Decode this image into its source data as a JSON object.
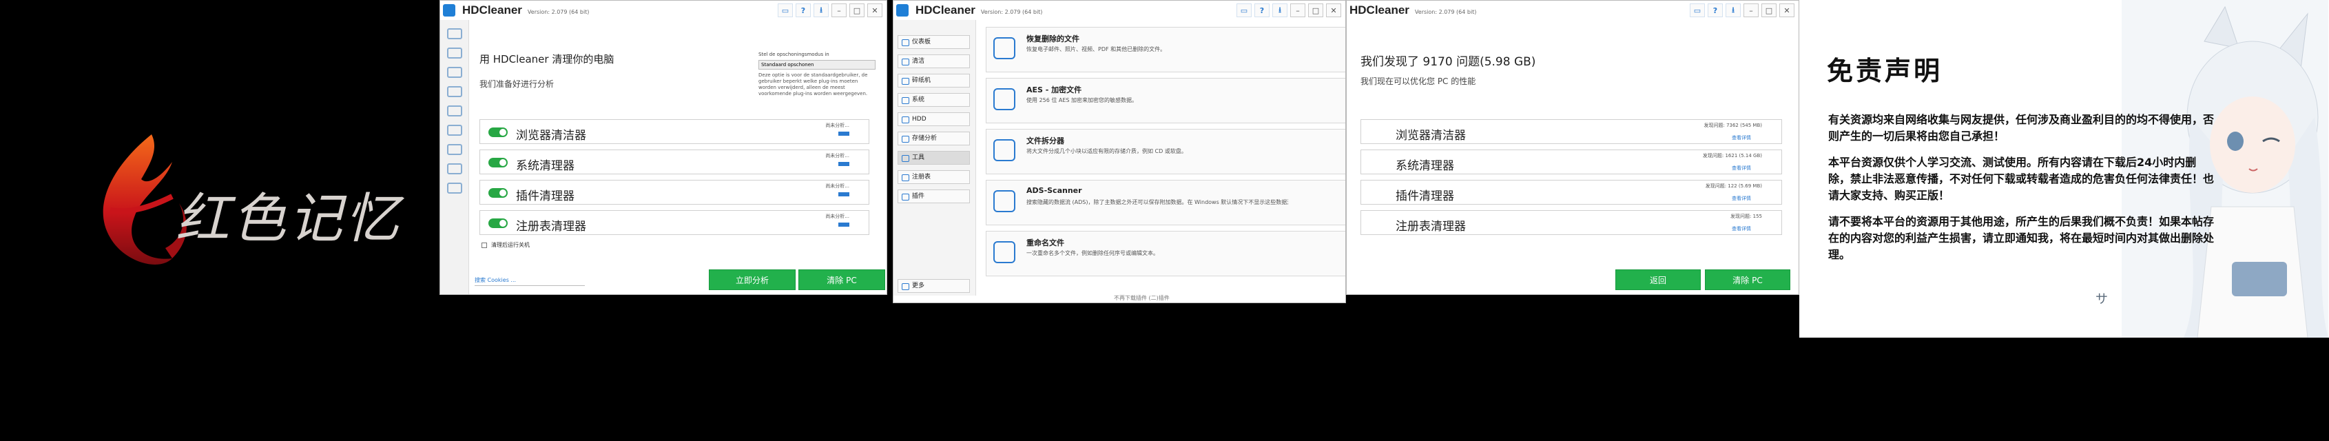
{
  "logo": {
    "text": "红色记忆"
  },
  "window1": {
    "app_name": "HDCleaner",
    "version": "Version: 2.079 (64 bit)",
    "heading": "用 HDCleaner 清理你的电脑",
    "subheading": "我们准备好进行分析",
    "mode_label": "Stel de opschoningsmodus in",
    "mode_value": "Standaard opschonen",
    "mode_desc": "Deze optie is voor de standaardgebruiker, de gebruiker beperkt welke plug-ins moeten worden verwijderd, alleen de meest voorkomende plug-ins worden weergegeven.",
    "items": [
      {
        "label": "浏览器清洁器",
        "status": "尚未分析..."
      },
      {
        "label": "系统清理器",
        "status": "尚未分析..."
      },
      {
        "label": "插件清理器",
        "status": "尚未分析..."
      },
      {
        "label": "注册表清理器",
        "status": "尚未分析..."
      }
    ],
    "checkbox_label": "清理后运行关机",
    "search_placeholder": "搜索 Cookies ...",
    "btn_analyze": "立即分析",
    "btn_clean": "清除 PC"
  },
  "window2": {
    "app_name": "HDCleaner",
    "version": "Version: 2.079 (64 bit)",
    "nav": [
      "仪表板",
      "清洁",
      "碎纸机",
      "系统",
      "HDD",
      "存储分析",
      "工具",
      "注册表",
      "插件"
    ],
    "nav_bottom": "更多",
    "cards": [
      {
        "title": "恢复删除的文件",
        "desc": "恢复电子邮件、照片、视频、PDF 和其他已删除的文件。"
      },
      {
        "title": "AES - 加密文件",
        "desc": "使用 256 位 AES 加密来加密您的敏感数据。"
      },
      {
        "title": "文件拆分器",
        "desc": "将大文件分成几个小块以适应有限的存储介质，例如 CD 或软盘。"
      },
      {
        "title": "ADS-Scanner",
        "desc": "搜索隐藏的数据流 (ADS)，除了主数据之外还可以保存附加数据。在 Windows 默认情况下不显示这些数据流。因此可以用于隐藏恶意软件或数据。"
      },
      {
        "title": "重命名文件",
        "desc": "一次重命名多个文件，例如删除任何序号或编辑文本。"
      }
    ],
    "footer": "不再下载插件 (二)插件"
  },
  "window3": {
    "app_name": "HDCleaner",
    "version": "Version: 2.079 (64 bit)",
    "heading": "我们发现了 9170 问题(5.98 GB)",
    "subheading": "我们现在可以优化您 PC 的性能",
    "items": [
      {
        "label": "浏览器清洁器",
        "status": "发现问题: 7362 (545 MB)",
        "link": "查看详情"
      },
      {
        "label": "系统清理器",
        "status": "发现问题: 1621 (5.14 GB)",
        "link": "查看详情"
      },
      {
        "label": "插件清理器",
        "status": "发现问题: 122 (5.69 MB)",
        "link": "查看详情"
      },
      {
        "label": "注册表清理器",
        "status": "发现问题: 155",
        "link": "查看详情"
      }
    ],
    "btn_back": "返回",
    "btn_clean": "清除 PC"
  },
  "disclaimer": {
    "title": "免责声明",
    "paragraphs": [
      "有关资源均来自网络收集与网友提供，任何涉及商业盈利目的的均不得使用，否则产生的一切后果将由您自己承担！",
      "本平台资源仅供个人学习交流、测试使用。所有内容请在下载后24小时内删除，禁止非法恶意传播，不对任何下载或转载者造成的危害负任何法律责任！也请大家支持、购买正版！",
      "请不要将本平台的资源用于其他用途，所产生的后果我们概不负责！如果本帖存在的内容对您的利益产生损害，请立即通知我，将在最短时间内对其做出删除处理。"
    ],
    "character_text": "サ",
    "colors": {
      "accent_bg": "#eef3f7",
      "hair": "#e9eef4"
    }
  },
  "colors": {
    "green": "#22b14c",
    "blue": "#2a7ad0"
  }
}
